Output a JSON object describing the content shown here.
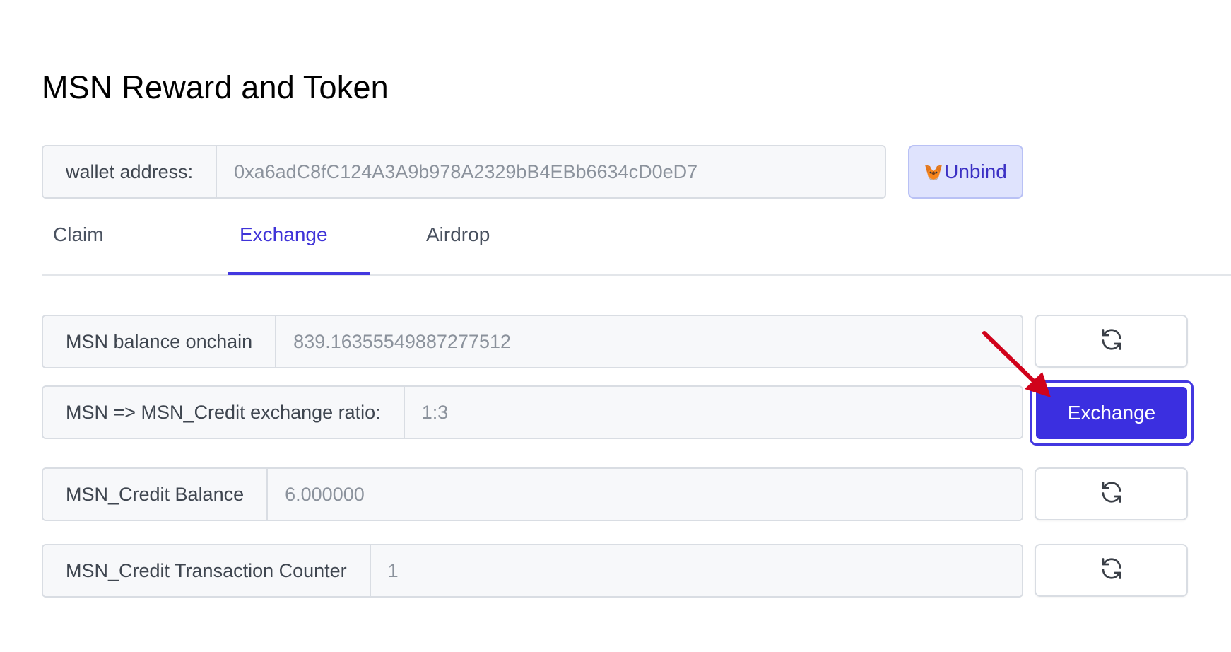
{
  "page": {
    "title": "MSN Reward and Token"
  },
  "wallet": {
    "label": "wallet address:",
    "value": "0xa6adC8fC124A3A9b978A2329bB4EBb6634cD0eD7",
    "unbind_label": "Unbind"
  },
  "tabs": [
    {
      "label": "Claim",
      "active": false
    },
    {
      "label": "Exchange",
      "active": true
    },
    {
      "label": "Airdrop",
      "active": false
    }
  ],
  "exchange": {
    "balance_label": "MSN balance onchain",
    "balance_value": "839.16355549887277512",
    "ratio_label": "MSN => MSN_Credit exchange ratio:",
    "ratio_value": "1:3",
    "exchange_button": "Exchange",
    "credit_balance_label": "MSN_Credit Balance",
    "credit_balance_value": "6.000000",
    "tx_counter_label": "MSN_Credit Transaction Counter",
    "tx_counter_value": "1"
  },
  "icons": {
    "refresh": "refresh-icon",
    "wallet": "metamask-fox-icon",
    "annotation": "red-arrow-annotation"
  },
  "colors": {
    "accent": "#3b2fe0",
    "annotation_arrow": "#d0021b",
    "unbind_bg": "#dfe3fd"
  }
}
